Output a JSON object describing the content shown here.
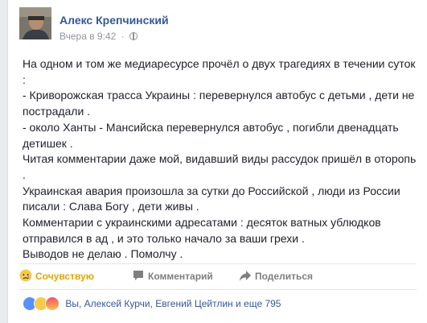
{
  "post": {
    "author": "Алекс Крепчинский",
    "time": "Вчера в 9:42",
    "separator": "·",
    "paragraphs": [
      "На одном и том же медиаресурсе прочёл о двух трагедиях в течении суток :",
      "- Криворожская трасса Украины : перевернулся автобус с детьми , дети не пострадали .",
      "- около Ханты - Мансийска перевернулся автобус , погибли двенадцать детишек .",
      "Читая комментарии даже мой, видавший виды рассудок пришёл в оторопь .",
      "Украинская авария произошла за сутки до Российской , люди из России писали : Слава Богу , дети живы .",
      "Комментарии с украинскими адресатами : десяток ватных ублюдков отправился в ад , и это только начало за ваши грехи .",
      "Выводов не делаю . Помолчу ."
    ]
  },
  "actions": {
    "like_label": "Сочувствую",
    "comment_label": "Комментарий",
    "share_label": "Поделиться"
  },
  "reactions": {
    "text": "Вы, Алексей Курчи, Евгений Цейтлин и еще 795",
    "icons": [
      "like-icon",
      "sad-icon",
      "angry-icon"
    ]
  },
  "colors": {
    "author": "#365899",
    "meta": "#90949c",
    "like_active": "#e0a600",
    "text": "#1d2129"
  }
}
